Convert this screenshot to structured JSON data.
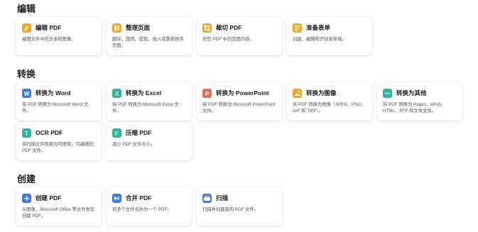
{
  "sections": {
    "edit": {
      "title": "编辑",
      "cards": [
        {
          "title": "编辑 PDF",
          "desc": "编辑文件中的文本和图像。",
          "icon": "edit-pdf-icon",
          "color": "#f5a623"
        },
        {
          "title": "整理页面",
          "desc": "删除、旋转、提取、插入或重新排序页面。",
          "icon": "organize-pages-icon",
          "color": "#f5a623"
        },
        {
          "title": "裁切 PDF",
          "desc": "修剪 PDF 中的页面内容。",
          "icon": "crop-pdf-icon",
          "color": "#f5a623"
        },
        {
          "title": "准备表单",
          "desc": "创建、编辑和识别表单域。",
          "icon": "prepare-form-icon",
          "color": "#f5a623"
        }
      ]
    },
    "convert": {
      "title": "转换",
      "cards": [
        {
          "title": "转换为 Word",
          "desc": "将 PDF 转换为 Microsoft Word 文件。",
          "icon": "word-icon",
          "color": "#3b7be8"
        },
        {
          "title": "转换为 Excel",
          "desc": "将 PDF 转换为 Microsoft Excel 文件。",
          "icon": "excel-icon",
          "color": "#2fb59a"
        },
        {
          "title": "转换为 PowerPoint",
          "desc": "将 PDF 转换为 Microsoft PowerPoint 文件。",
          "icon": "powerpoint-icon",
          "color": "#f06b4f"
        },
        {
          "title": "转换为图像",
          "desc": "将 PDF 转换为图像（JPEG、PNG、GIF 和 TIFF）。",
          "icon": "image-icon",
          "color": "#f5a623"
        },
        {
          "title": "转换为其他",
          "desc": "将 PDF 转换为 Pages、ePub、HTML、RTF 和文本文件。",
          "icon": "other-format-icon",
          "color": "#2fb59a"
        },
        {
          "title": "OCR PDF",
          "desc": "将扫描文件转换为可搜索、可编辑的 PDF 文件。",
          "icon": "ocr-icon",
          "color": "#2fb59a"
        },
        {
          "title": "压缩 PDF",
          "desc": "减小 PDF 文件大小。",
          "icon": "compress-icon",
          "color": "#2fb59a"
        }
      ]
    },
    "create": {
      "title": "创建",
      "cards": [
        {
          "title": "创建 PDF",
          "desc": "从图像、Microsoft Office 等文件类型创建 PDF。",
          "icon": "create-pdf-icon",
          "color": "#3b7be8"
        },
        {
          "title": "合并 PDF",
          "desc": "将多个文件合并为一个 PDF。",
          "icon": "combine-pdf-icon",
          "color": "#3b7be8"
        },
        {
          "title": "扫描",
          "desc": "扫描并创建新的 PDF 文件。",
          "icon": "scan-icon",
          "color": "#3b7be8"
        }
      ]
    }
  }
}
